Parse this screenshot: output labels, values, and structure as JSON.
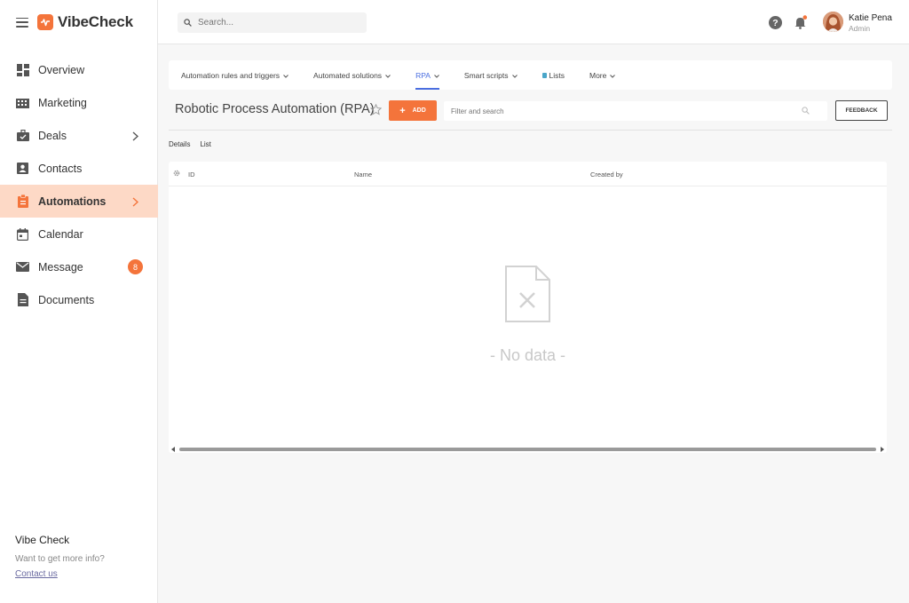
{
  "brand": {
    "name": "VibeCheck",
    "accent": "#f4743b"
  },
  "search": {
    "placeholder": "Search..."
  },
  "sidebar": {
    "items": [
      {
        "label": "Overview",
        "icon": "dashboard-icon"
      },
      {
        "label": "Marketing",
        "icon": "building-icon"
      },
      {
        "label": "Deals",
        "icon": "briefcase-icon",
        "has_chevron": true
      },
      {
        "label": "Contacts",
        "icon": "contact-card-icon"
      },
      {
        "label": "Automations",
        "icon": "clipboard-icon",
        "has_chevron": true,
        "active": true
      },
      {
        "label": "Calendar",
        "icon": "calendar-icon"
      },
      {
        "label": "Message",
        "icon": "mail-icon",
        "badge": "8"
      },
      {
        "label": "Documents",
        "icon": "document-icon"
      }
    ],
    "footer": {
      "title": "Vibe Check",
      "text": "Want to get more info?",
      "link": "Contact us"
    }
  },
  "user": {
    "name": "Katie Pena",
    "role": "Admin"
  },
  "tabs": [
    {
      "label": "Automation rules and triggers",
      "dropdown": true
    },
    {
      "label": "Automated solutions",
      "dropdown": true
    },
    {
      "label": "RPA",
      "dropdown": true,
      "active": true
    },
    {
      "label": "Smart scripts",
      "dropdown": true
    },
    {
      "label": "Lists",
      "locked": true
    },
    {
      "label": "More",
      "dropdown": true
    }
  ],
  "page": {
    "title": "Robotic Process Automation (RPA)",
    "add_label": "ADD",
    "filter_placeholder": "Filter and search",
    "feedback_label": "FEEDBACK"
  },
  "views": [
    "Details",
    "List"
  ],
  "table": {
    "columns": [
      "ID",
      "Name",
      "Created by"
    ],
    "empty_text": "- No data -"
  }
}
